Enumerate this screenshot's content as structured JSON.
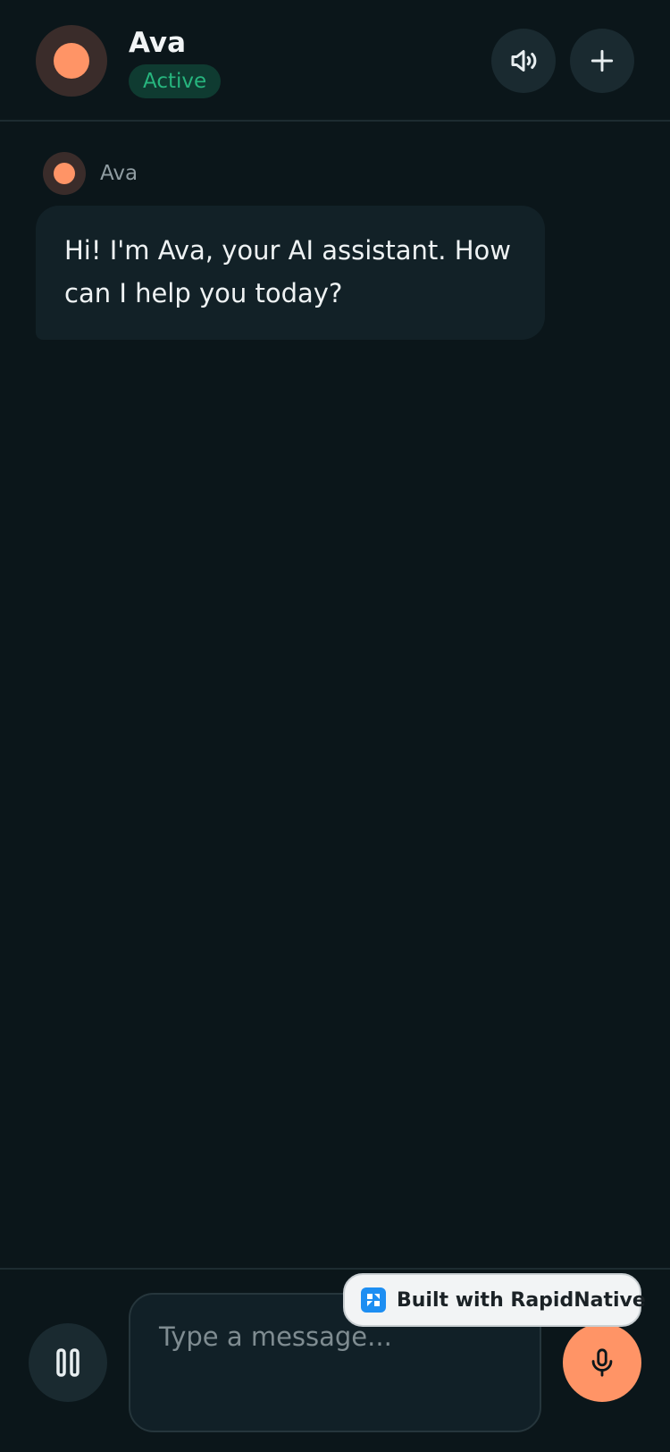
{
  "header": {
    "assistant_name": "Ava",
    "status": "Active",
    "speaker_icon": "speaker-icon",
    "new_chat_icon": "plus-icon"
  },
  "messages": [
    {
      "sender": "Ava",
      "text": "Hi! I'm Ava, your AI assistant. How can I help you today?"
    }
  ],
  "composer": {
    "placeholder": "Type a message...",
    "pause_icon": "pause-icon",
    "mic_icon": "microphone-icon"
  },
  "badge": {
    "text": "Built with RapidNative"
  },
  "colors": {
    "background": "#0b161a",
    "accent": "#ff9466",
    "status_green": "#27b57e",
    "bubble": "#122127"
  }
}
